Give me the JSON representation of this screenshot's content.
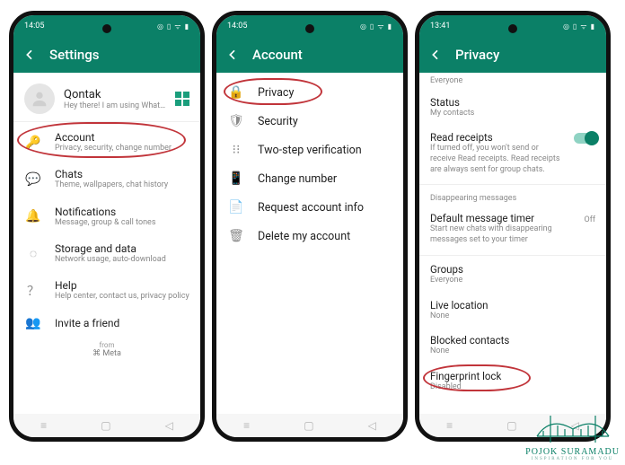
{
  "status": {
    "time1": "14:05",
    "time2": "14:05",
    "time3": "13:41",
    "icons": "◎ ▯ ᯤ ▮"
  },
  "phone1": {
    "title": "Settings",
    "profile": {
      "name": "Qontak",
      "status": "Hey there! I am using WhatsA..."
    },
    "items": [
      {
        "icon": "🔑",
        "title": "Account",
        "sub": "Privacy, security, change number"
      },
      {
        "icon": "💬",
        "title": "Chats",
        "sub": "Theme, wallpapers, chat history"
      },
      {
        "icon": "🔔",
        "title": "Notifications",
        "sub": "Message, group & call tones"
      },
      {
        "icon": "◌",
        "title": "Storage and data",
        "sub": "Network usage, auto-download"
      },
      {
        "icon": "？",
        "title": "Help",
        "sub": "Help center, contact us, privacy policy"
      },
      {
        "icon": "👥",
        "title": "Invite a friend",
        "sub": ""
      }
    ],
    "from": "from",
    "meta": "⌘ Meta"
  },
  "phone2": {
    "title": "Account",
    "items": [
      {
        "icon": "🔒",
        "title": "Privacy"
      },
      {
        "icon": "🛡",
        "title": "Security"
      },
      {
        "icon": "⁝⁝",
        "title": "Two-step verification"
      },
      {
        "icon": "📱",
        "title": "Change number"
      },
      {
        "icon": "📄",
        "title": "Request account info"
      },
      {
        "icon": "🗑",
        "title": "Delete my account"
      }
    ]
  },
  "phone3": {
    "title": "Privacy",
    "topSub": "Everyone",
    "items": [
      {
        "title": "Status",
        "sub": "My contacts"
      },
      {
        "title": "Read receipts",
        "sub": "If turned off, you won't send or receive Read receipts. Read receipts are always sent for group chats."
      }
    ],
    "section": "Disappearing messages",
    "defaultTimer": {
      "title": "Default message timer",
      "sub": "Start new chats with disappearing messages set to your timer",
      "val": "Off"
    },
    "items2": [
      {
        "title": "Groups",
        "sub": "Everyone"
      },
      {
        "title": "Live location",
        "sub": "None"
      },
      {
        "title": "Blocked contacts",
        "sub": "None"
      },
      {
        "title": "Fingerprint lock",
        "sub": "Disabled"
      }
    ]
  },
  "watermark": {
    "title": "POJOK SURAMADU",
    "sub": "INSPIRATION FOR YOU"
  }
}
